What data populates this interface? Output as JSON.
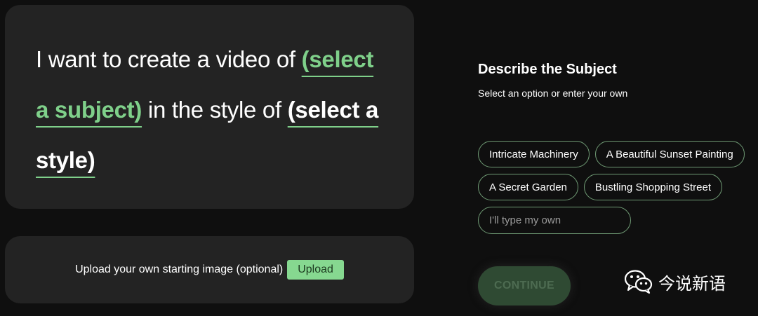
{
  "prompt": {
    "part1": "I want to create a video of ",
    "subject_select": "(select a subject)",
    "part2": " in the style of ",
    "style_select": "(select a style)"
  },
  "upload": {
    "label": "Upload your own starting image (optional)",
    "button_label": "Upload"
  },
  "subject_panel": {
    "heading_prefix": "Describe the ",
    "heading_bold": "Subject",
    "subheading": "Select an option or enter your own",
    "options": [
      "Intricate Machinery",
      "A Beautiful Sunset Painting",
      "A Secret Garden",
      "Bustling Shopping Street"
    ],
    "own_placeholder": "I'll type my own",
    "continue_label": "CONTINUE"
  },
  "watermark": {
    "icon": "wechat-icon",
    "text": "今说新语"
  },
  "colors": {
    "accent_green": "#7fd08a",
    "card_bg": "#232323",
    "page_bg": "#0f0f0f"
  }
}
